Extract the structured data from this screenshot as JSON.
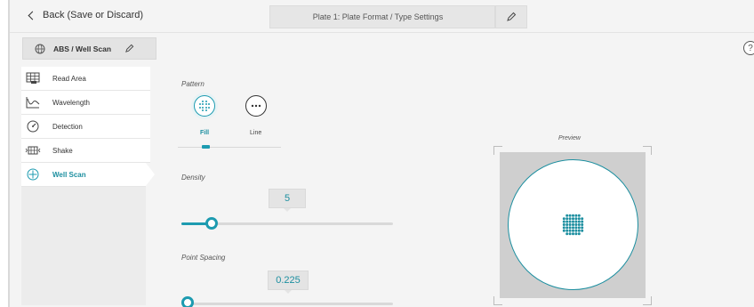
{
  "header": {
    "back_label": "Back (Save or Discard)",
    "plate_title": "Plate 1: Plate Format / Type Settings"
  },
  "method_tab": {
    "label": "ABS / Well Scan"
  },
  "help": {
    "label": "?"
  },
  "sidebar": {
    "items": [
      {
        "label": "Read Area",
        "icon": "read-area-icon"
      },
      {
        "label": "Wavelength",
        "icon": "wavelength-icon"
      },
      {
        "label": "Detection",
        "icon": "detection-icon"
      },
      {
        "label": "Shake",
        "icon": "shake-icon"
      },
      {
        "label": "Well Scan",
        "icon": "well-scan-icon",
        "active": true
      }
    ]
  },
  "pattern": {
    "label": "Pattern",
    "options": [
      {
        "label": "Fill",
        "selected": true
      },
      {
        "label": "Line",
        "selected": false
      }
    ]
  },
  "density": {
    "label": "Density",
    "value": "5",
    "fraction": 0.12
  },
  "point_spacing": {
    "label": "Point Spacing",
    "value": "0.225",
    "fraction": 0.0
  },
  "preview": {
    "label": "Preview"
  },
  "colors": {
    "accent": "#1d9bb0",
    "panel": "#f4f4f4",
    "preview_bg": "#cfcfcf"
  }
}
